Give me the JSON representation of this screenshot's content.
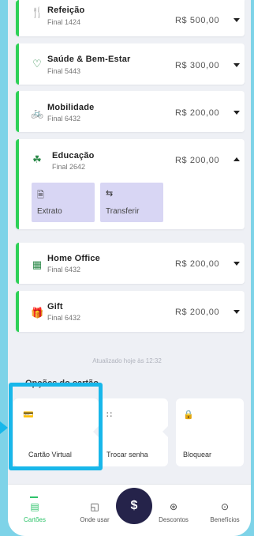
{
  "cards": [
    {
      "title": "Refeição",
      "subtitle": "Final 1424",
      "amount": "R$ 500,00",
      "icon": "meal-icon",
      "expanded": false
    },
    {
      "title": "Saúde & Bem-Estar",
      "subtitle": "Final 5443",
      "amount": "R$ 300,00",
      "icon": "health-icon",
      "expanded": false
    },
    {
      "title": "Mobilidade",
      "subtitle": "Final 6432",
      "amount": "R$ 200,00",
      "icon": "bike-icon",
      "expanded": false
    },
    {
      "title": "Educação",
      "subtitle": "Final 2642",
      "amount": "R$ 200,00",
      "icon": "education-icon",
      "expanded": true
    },
    {
      "title": "Home Office",
      "subtitle": "Final 6432",
      "amount": "R$ 200,00",
      "icon": "building-icon",
      "expanded": false
    },
    {
      "title": "Gift",
      "subtitle": "Final 6432",
      "amount": "R$ 200,00",
      "icon": "gift-icon",
      "expanded": false
    }
  ],
  "education_actions": [
    {
      "label": "Extrato",
      "icon": "document-icon"
    },
    {
      "label": "Transferir",
      "icon": "transfer-icon"
    }
  ],
  "updated_text": "Atualizado hoje às 12:32",
  "options_title": "Opções do cartão",
  "options": [
    {
      "label": "Cartão Virtual",
      "icon": "virtual-card-icon"
    },
    {
      "label": "Trocar senha",
      "icon": "keypad-icon"
    },
    {
      "label": "Bloquear",
      "icon": "lock-icon"
    }
  ],
  "tabs": [
    {
      "label": "Cartões",
      "icon": "cards-icon",
      "active": true
    },
    {
      "label": "Onde usar",
      "icon": "map-icon",
      "active": false
    },
    {
      "label": "$",
      "icon": "dollar-icon",
      "active": false
    },
    {
      "label": "Descontos",
      "icon": "discount-icon",
      "active": false
    },
    {
      "label": "Benefícios",
      "icon": "benefits-icon",
      "active": false
    }
  ],
  "colors": {
    "accent_green": "#2ed158",
    "highlight_blue": "#18b7ea",
    "fab": "#25234a",
    "action_bg": "#d8d6f4"
  }
}
